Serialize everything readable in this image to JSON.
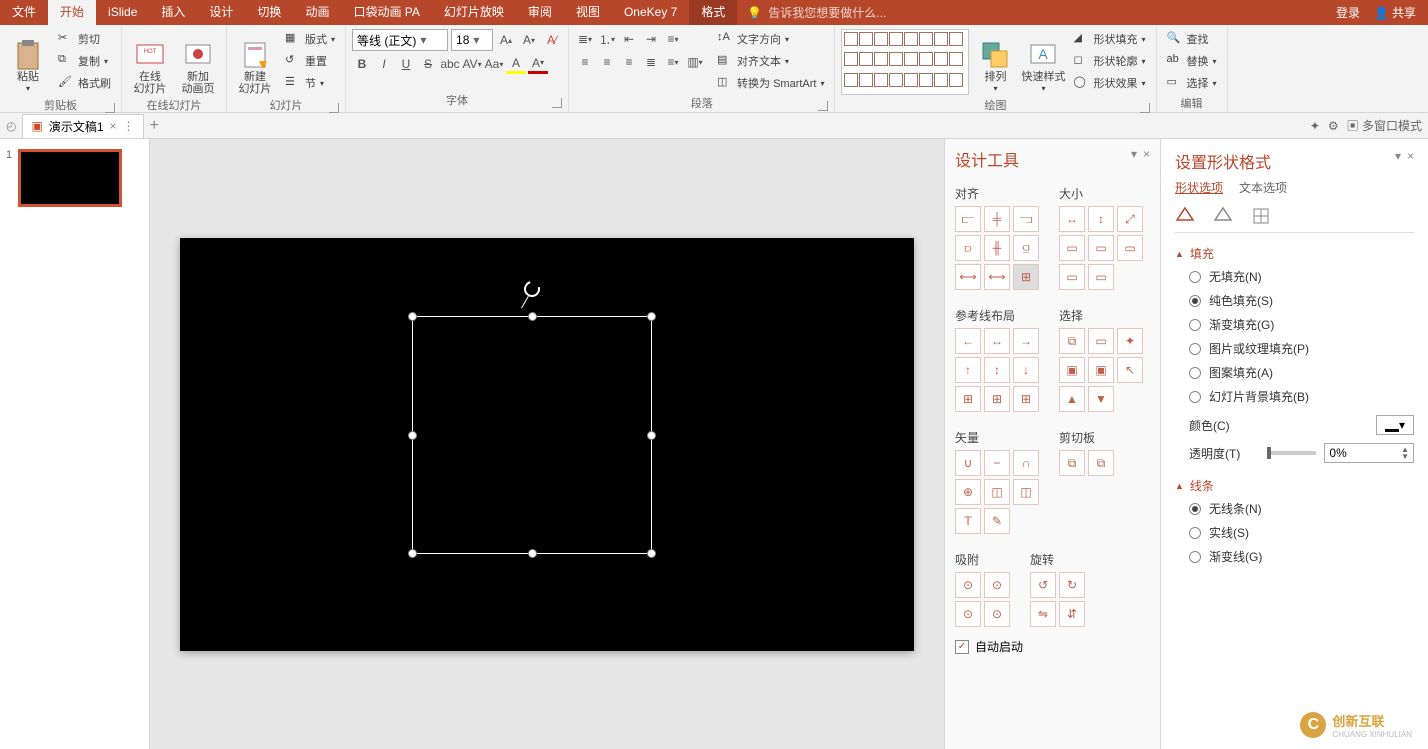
{
  "top_tabs": {
    "file": "文件",
    "home": "开始",
    "islide": "iSlide",
    "insert": "插入",
    "design": "设计",
    "transition": "切换",
    "animation": "动画",
    "pocket_anim": "口袋动画 PA",
    "slideshow": "幻灯片放映",
    "review": "审阅",
    "view": "视图",
    "onekey": "OneKey 7",
    "format": "格式",
    "search_hint": "告诉我您想要做什么...",
    "login": "登录",
    "share": "共享"
  },
  "ribbon": {
    "clipboard": {
      "paste": "粘贴",
      "cut": "剪切",
      "copy": "复制",
      "format_painter": "格式刷",
      "label": "剪贴板"
    },
    "online_slides": {
      "online": "在线\n幻灯片",
      "new_anim": "新加\n动画页",
      "label": "在线幻灯片"
    },
    "slides": {
      "new_slide": "新建\n幻灯片",
      "layout": "版式",
      "reset": "重置",
      "section": "节",
      "label": "幻灯片"
    },
    "font": {
      "name": "等线 (正文)",
      "size": "18",
      "label": "字体"
    },
    "paragraph": {
      "label": "段落",
      "text_direction": "文字方向",
      "align_text": "对齐文本",
      "convert_smartart": "转换为 SmartArt"
    },
    "drawing": {
      "arrange": "排列",
      "quick_styles": "快速样式",
      "shape_fill": "形状填充",
      "shape_outline": "形状轮廓",
      "shape_effects": "形状效果",
      "label": "绘图"
    },
    "editing": {
      "find": "查找",
      "replace": "替换",
      "select": "选择",
      "label": "编辑"
    }
  },
  "doc_tab": {
    "name": "演示文稿1",
    "multi_window": "多窗口模式"
  },
  "design_tools": {
    "title": "设计工具",
    "align": "对齐",
    "size": "大小",
    "guides_layout": "参考线布局",
    "selection": "选择",
    "vector": "矢量",
    "clipboard": "剪切板",
    "snap": "吸附",
    "rotate": "旋转",
    "auto_start": "自动启动"
  },
  "format_shape": {
    "title": "设置形状格式",
    "shape_options": "形状选项",
    "text_options": "文本选项",
    "fill": {
      "header": "填充",
      "no_fill": "无填充(N)",
      "solid_fill": "纯色填充(S)",
      "gradient_fill": "渐变填充(G)",
      "picture_fill": "图片或纹理填充(P)",
      "pattern_fill": "图案填充(A)",
      "slide_bg_fill": "幻灯片背景填充(B)",
      "color": "颜色(C)",
      "transparency": "透明度(T)",
      "transparency_value": "0%"
    },
    "line": {
      "header": "线条",
      "no_line": "无线条(N)",
      "solid_line": "实线(S)",
      "gradient_line": "渐变线(G)"
    }
  },
  "watermark": {
    "text": "创新互联",
    "sub": "CHUANG XINHULIAN"
  },
  "slide_number": "1"
}
